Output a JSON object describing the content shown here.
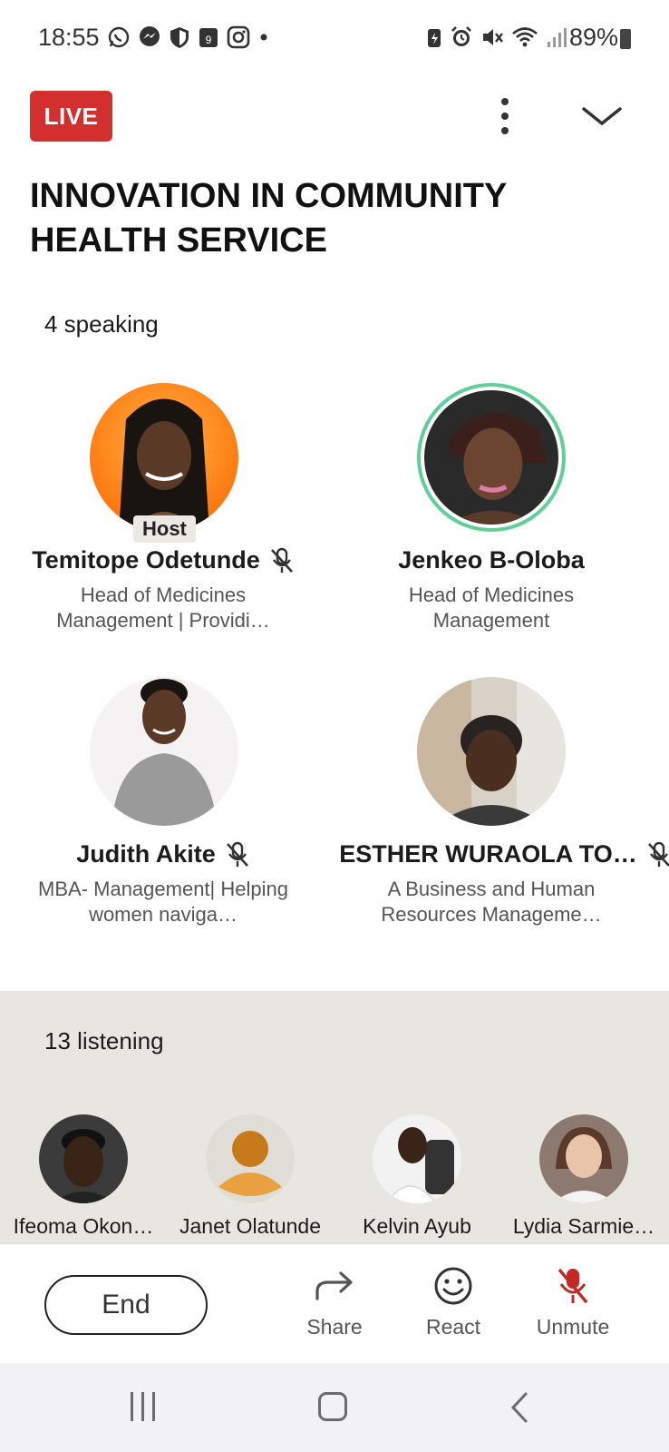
{
  "status_bar": {
    "time": "18:55",
    "battery": "89%",
    "left_icons": [
      "whatsapp-icon",
      "messenger-icon",
      "shield-icon",
      "calendar-icon",
      "instagram-icon",
      "dot-icon"
    ],
    "right_icons": [
      "battery-saver-icon",
      "alarm-icon",
      "mute-icon",
      "wifi-icon",
      "signal-icon"
    ],
    "calendar_day": "9"
  },
  "header": {
    "live_label": "LIVE",
    "title": "INNOVATION IN COMMUNITY HEALTH SERVICE"
  },
  "speakers": {
    "count_label": "4 speaking",
    "host_label": "Host",
    "items": [
      {
        "name": "Temitope Odetunde",
        "headline": "Head of Medicines Management  | Providi…",
        "muted": true,
        "is_host": true
      },
      {
        "name": "Jenkeo B-Oloba",
        "headline": "Head of Medicines Management",
        "muted": false,
        "is_host": false
      },
      {
        "name": "Judith Akite",
        "headline": "MBA- Management| Helping women naviga…",
        "muted": true,
        "is_host": false
      },
      {
        "name": "ESTHER WURAOLA TO…",
        "headline": "A Business and Human Resources Manageme…",
        "muted": true,
        "is_host": false
      }
    ]
  },
  "listeners": {
    "count_label": "13 listening",
    "items": [
      {
        "name": "Ifeoma Okon…"
      },
      {
        "name": "Janet Olatunde"
      },
      {
        "name": "Kelvin Ayub"
      },
      {
        "name": "Lydia Sarmie…"
      }
    ]
  },
  "actions": {
    "end_label": "End",
    "share_label": "Share",
    "react_label": "React",
    "unmute_label": "Unmute"
  },
  "colors": {
    "live_red": "#d32f2f",
    "muted_red": "#c62828",
    "speaking_ring": "#5fcf9a",
    "listening_bg": "#e8e6e1"
  }
}
